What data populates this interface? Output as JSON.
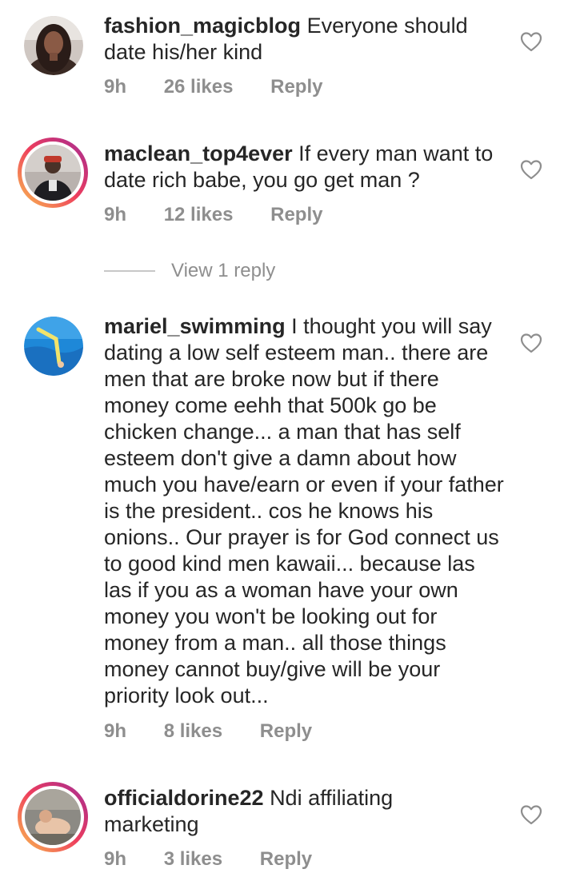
{
  "comments": [
    {
      "username": "fashion_magicblog",
      "text": "Everyone should date his/her kind",
      "time": "9h",
      "likes": "26 likes",
      "reply_label": "Reply",
      "story_ring": false
    },
    {
      "username": "maclean_top4ever",
      "text": "If every man want to date rich babe, you go get man ?",
      "time": "9h",
      "likes": "12 likes",
      "reply_label": "Reply",
      "story_ring": true,
      "view_replies": "View 1 reply"
    },
    {
      "username": "mariel_swimming",
      "text": "I thought you will say dating a low self esteem man.. there are men that are broke now but if there money come eehh that 500k go be chicken change... a man that has self esteem don't give a damn about how much you have/earn or even if your father is the president.. cos he knows his onions.. Our prayer is for God connect us to good kind men kawaii... because las las if you as a woman have your own money you won't be looking out for money from a man.. all those things money cannot buy/give will be your priority look out...",
      "time": "9h",
      "likes": "8 likes",
      "reply_label": "Reply",
      "story_ring": false
    },
    {
      "username": "officialdorine22",
      "text": "Ndi affiliating marketing",
      "time": "9h",
      "likes": "3 likes",
      "reply_label": "Reply",
      "story_ring": true
    }
  ],
  "icons": {
    "like": "heart-outline-icon"
  },
  "colors": {
    "text": "#262626",
    "secondary": "#8e8e8e",
    "ring_start": "#f9c04f",
    "ring_end": "#a43ba1"
  }
}
